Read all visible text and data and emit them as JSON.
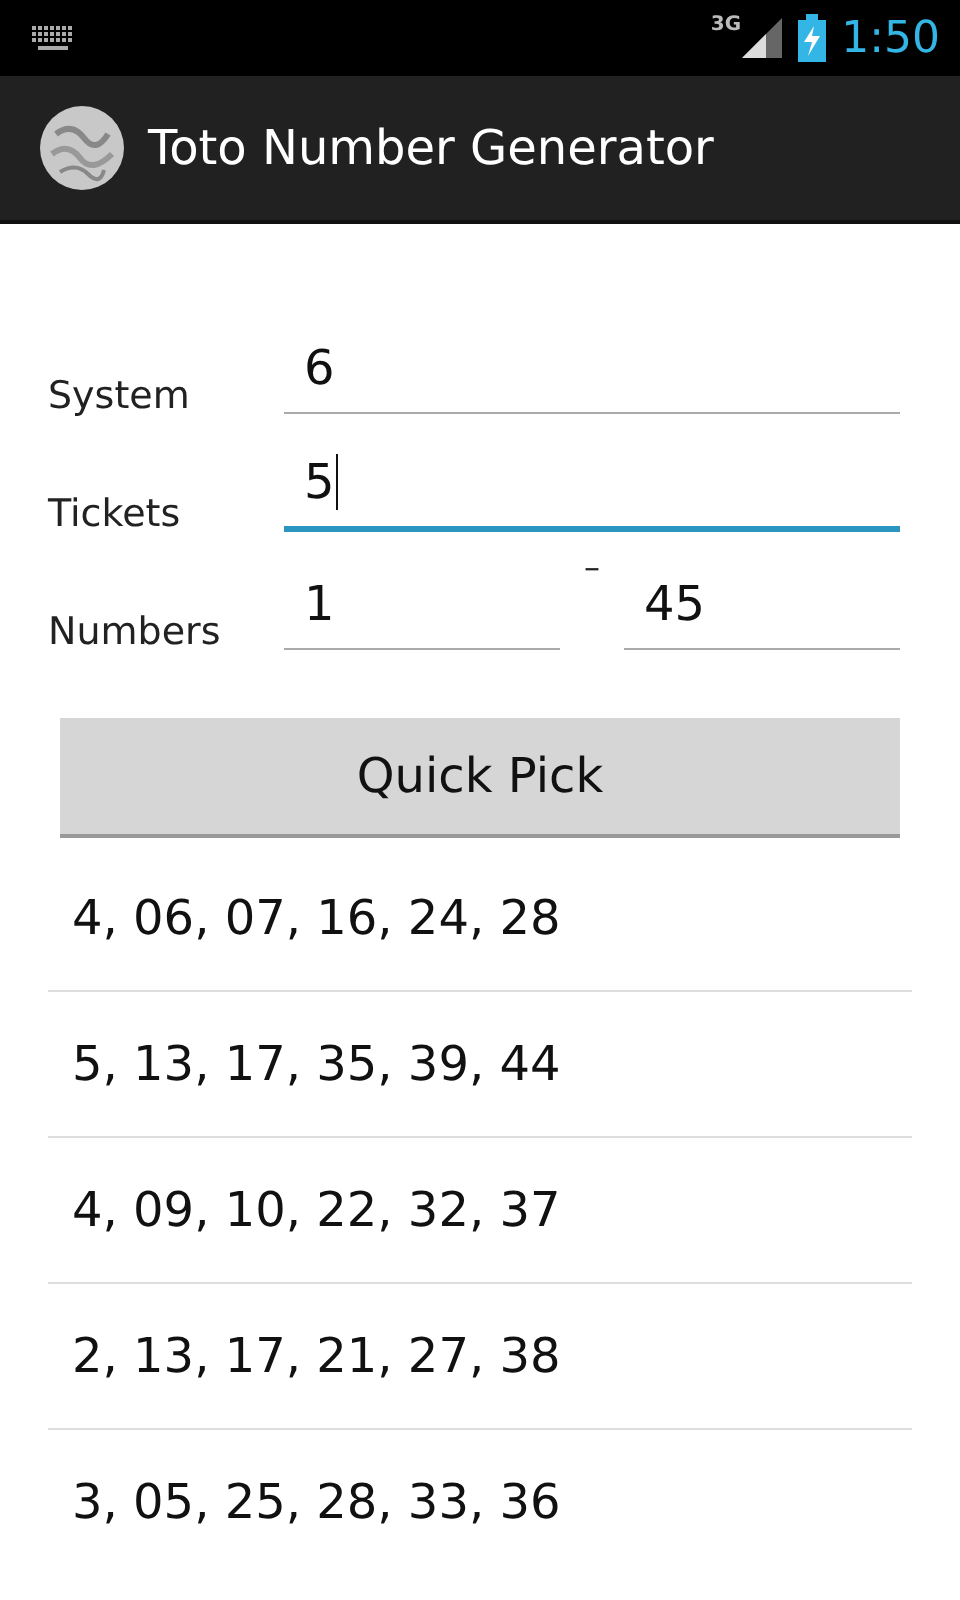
{
  "status_bar": {
    "network": "3G",
    "time": "1:50"
  },
  "app_bar": {
    "title": "Toto Number Generator"
  },
  "form": {
    "system": {
      "label": "System",
      "value": "6",
      "focused": false
    },
    "tickets": {
      "label": "Tickets",
      "value": "5",
      "focused": true
    },
    "numbers": {
      "label": "Numbers",
      "from": {
        "value": "1",
        "focused": false
      },
      "separator": "–",
      "to": {
        "value": "45",
        "focused": false
      }
    }
  },
  "quick_pick_button": "Quick Pick",
  "results": [
    "4, 06, 07, 16, 24, 28",
    "5, 13, 17, 35, 39, 44",
    "4, 09, 10, 22, 32, 37",
    "2, 13, 17, 21, 27, 38",
    "3, 05, 25, 28, 33, 36"
  ]
}
